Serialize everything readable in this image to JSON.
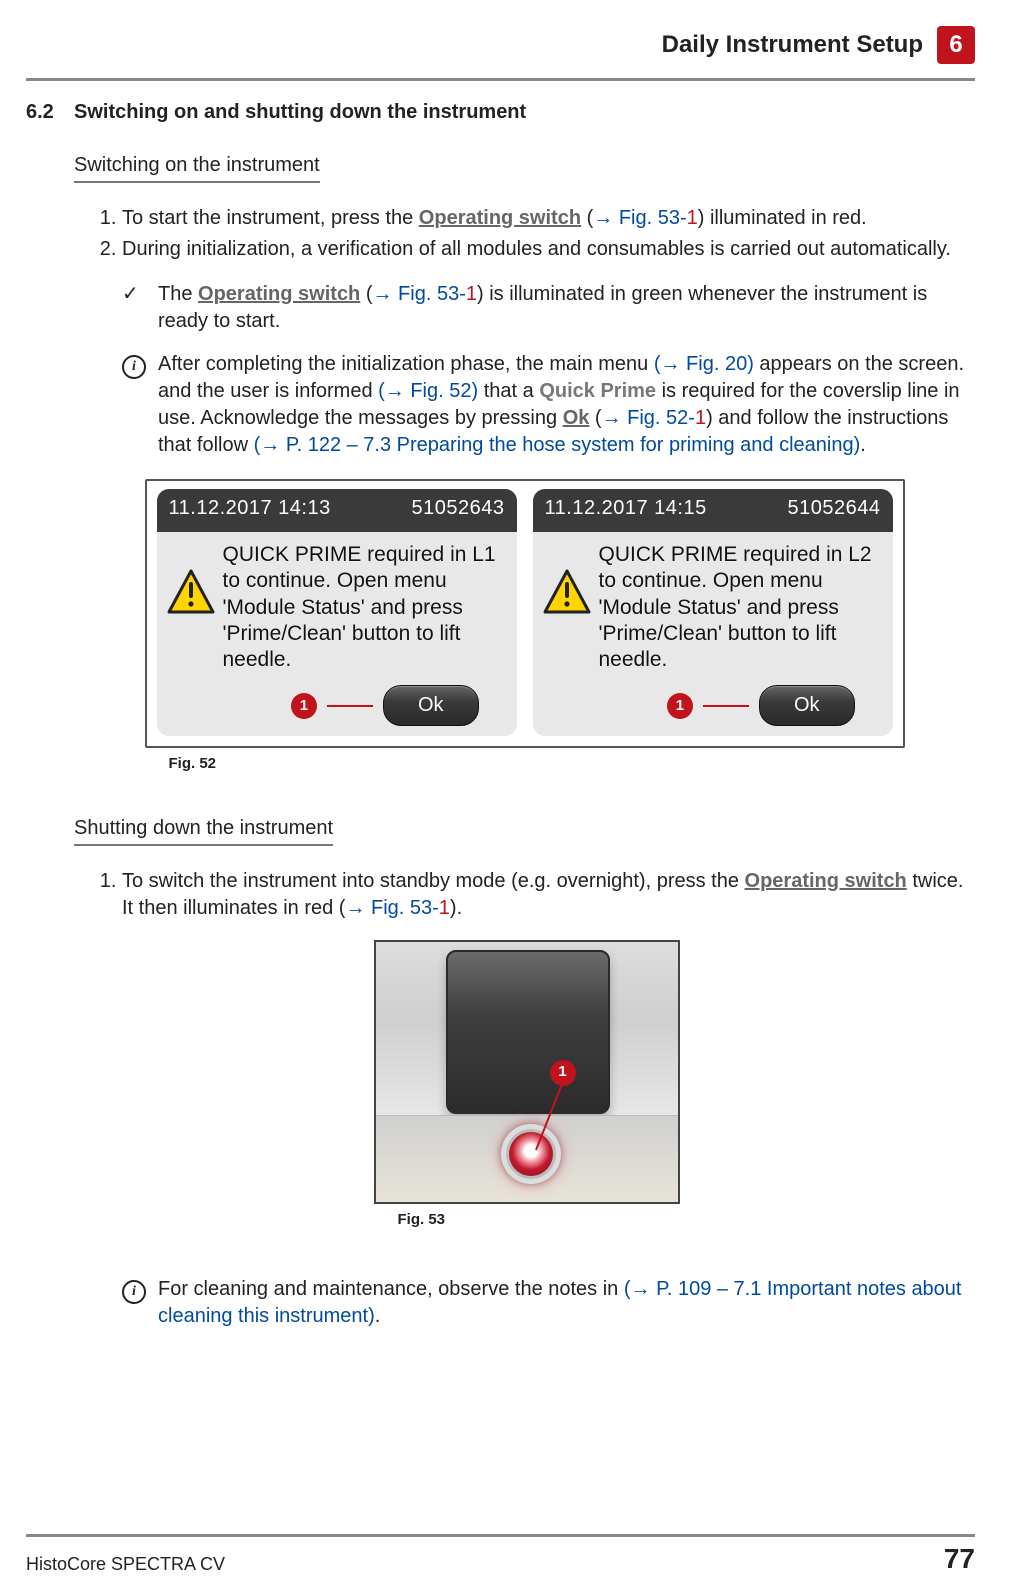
{
  "header": {
    "chapter_title": "Daily Instrument Setup",
    "chapter_number": "6"
  },
  "section": {
    "number": "6.2",
    "title": "Switching on and shutting down the instrument"
  },
  "switch_on": {
    "heading": "Switching on the instrument",
    "steps": {
      "s1_a": "To start the instrument, press the ",
      "s1_op": "Operating switch",
      "s1_b": " (",
      "s1_ref": "→ Fig.  53-",
      "s1_ref_red": "1",
      "s1_c": ") illuminated in red.",
      "s2": "During initialization, a verification of all modules and consumables is carried out automatically."
    },
    "check": {
      "a": "The ",
      "op": "Operating switch",
      "b": " (",
      "ref": "→ Fig.  53-",
      "ref_red": "1",
      "c": ") is illuminated in green whenever the instrument is ready to start."
    },
    "info": {
      "a": "After completing the initialization phase, the main menu ",
      "ref1": "(→ Fig.  20)",
      "b": " appears on the screen. and the user is informed ",
      "ref2": "(→ Fig.  52)",
      "c": " that a ",
      "qp": "Quick Prime",
      "d": " is required for the coverslip line in use. Acknowledge the messages by pressing ",
      "ok": "Ok",
      "e": " (",
      "ref3": "→ Fig.  52-",
      "ref3_red": "1",
      "f": ") and follow the instructions that follow ",
      "ref4": "(→ P. 122 – 7.3 Preparing the hose system for priming and cleaning)",
      "g": "."
    }
  },
  "fig52": {
    "caption": "Fig.  52",
    "left": {
      "timestamp": "11.12.2017 14:13",
      "id": "51052643",
      "msg": "QUICK PRIME required in L1 to continue. Open menu 'Module Status' and press 'Prime/Clean' button to lift needle.",
      "ok": "Ok",
      "callout": "1"
    },
    "right": {
      "timestamp": "11.12.2017 14:15",
      "id": "51052644",
      "msg": "QUICK PRIME required in L2 to continue. Open menu 'Module Status' and press 'Prime/Clean' button to lift needle.",
      "ok": "Ok",
      "callout": "1"
    }
  },
  "shut_down": {
    "heading": "Shutting down the instrument",
    "s1_a": "To switch the instrument into standby mode (e.g. overnight), press the ",
    "s1_op": "Operating switch",
    "s1_b": " twice. It then illuminates in red (",
    "s1_ref": "→ Fig.  53-",
    "s1_ref_red": "1",
    "s1_c": ")."
  },
  "fig53": {
    "caption": "Fig.  53",
    "callout": "1"
  },
  "final_info": {
    "a": "For cleaning and maintenance, observe the notes in ",
    "ref": "(→ P. 109 – 7.1 Important notes about cleaning this instrument)",
    "b": "."
  },
  "footer": {
    "product": "HistoCore SPECTRA CV",
    "page": "77"
  }
}
